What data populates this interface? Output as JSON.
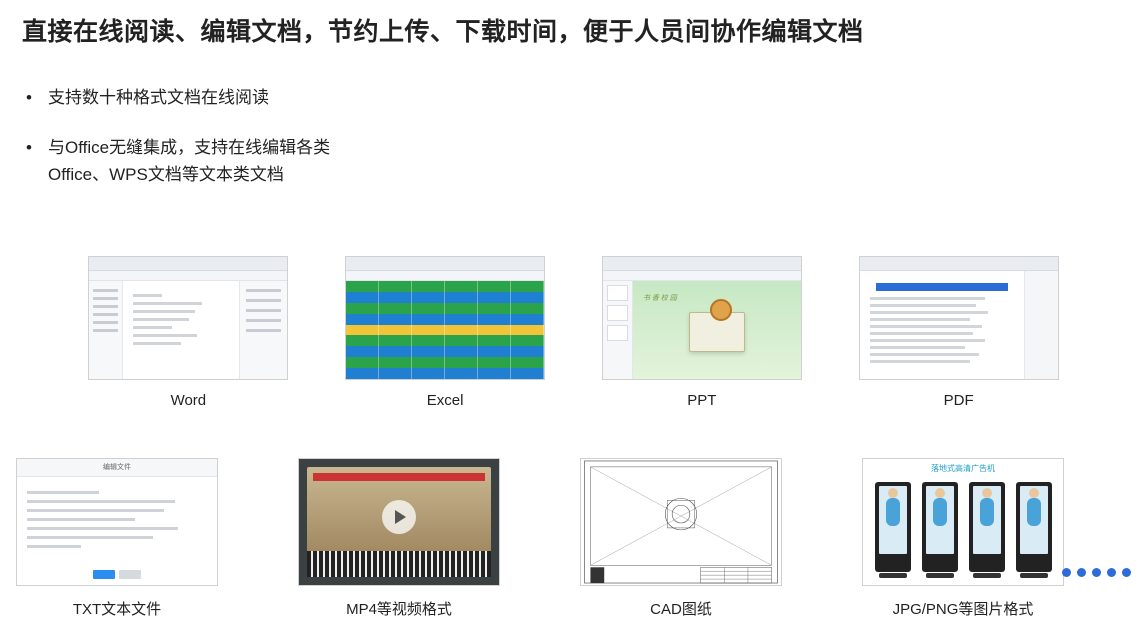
{
  "title": "直接在线阅读、编辑文档，节约上传、下载时间，便于人员间协作编辑文档",
  "bullets": [
    "支持数十种格式文档在线阅读",
    "与Office无缝集成，支持在线编辑各类Office、WPS文档等文本类文档"
  ],
  "row1": [
    {
      "caption": "Word"
    },
    {
      "caption": "Excel"
    },
    {
      "caption": "PPT"
    },
    {
      "caption": "PDF"
    }
  ],
  "row2": [
    {
      "caption": "TXT文本文件"
    },
    {
      "caption": "MP4等视频格式"
    },
    {
      "caption": "CAD图纸"
    },
    {
      "caption": "JPG/PNG等图片格式"
    }
  ],
  "txt_header": "编辑文件",
  "jpg_header": "落地式高清广告机",
  "dots_count": 5
}
